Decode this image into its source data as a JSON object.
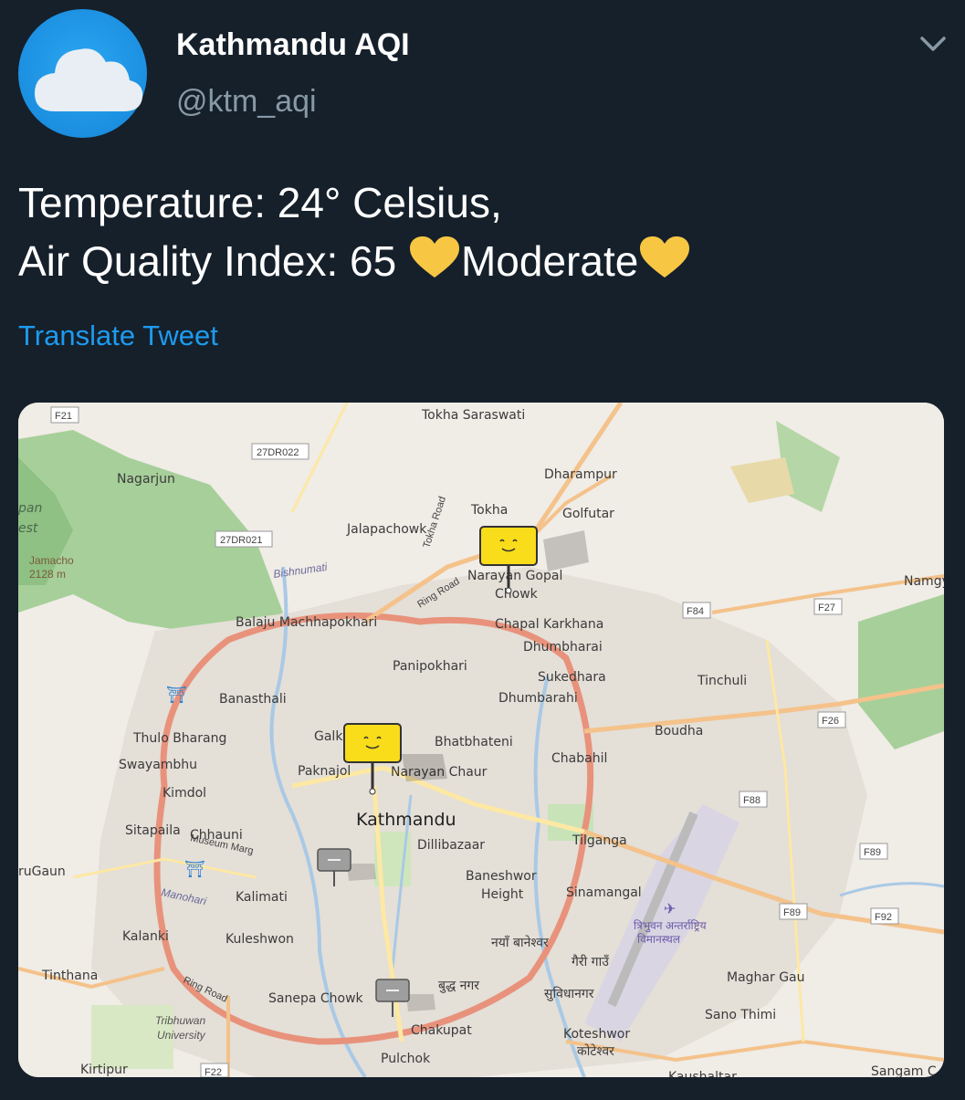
{
  "account": {
    "display_name": "Kathmandu AQI",
    "handle": "@ktm_aqi",
    "avatar_icon": "cloud-icon"
  },
  "tweet": {
    "line1": "Temperature: 24° Celsius,",
    "line2_prefix": "Air Quality Index: 65 ",
    "line2_status": "Moderate",
    "heart_color": "#f7c744"
  },
  "translate_label": "Translate Tweet",
  "colors": {
    "background": "#15202b",
    "link": "#1d9bf0",
    "muted": "#8899a6",
    "marker_moderate": "#f9dc1a",
    "marker_nodata": "#9e9e9e"
  },
  "map": {
    "place_labels": {
      "tokha_saraswati": "Tokha Saraswati",
      "nagarjun": "Nagarjun",
      "dharampur": "Dharampur",
      "tokha": "Tokha",
      "golfutar": "Golfutar",
      "jalapachowk": "Jalapachowk",
      "narayan_gopal": "Narayan Gopal",
      "chowk": "Chowk",
      "namgy": "Namgy",
      "chapal_karkhana": "Chapal Karkhana",
      "dhumbharai": "Dhumbharai",
      "balaju": "Balaju Machhapokhari",
      "panipokhari": "Panipokhari",
      "sukedhara": "Sukedhara",
      "dhumbarahi": "Dhumbarahi",
      "tinchuli": "Tinchuli",
      "banasthali": "Banasthali",
      "boudha": "Boudha",
      "thulo_bharang": "Thulo Bharang",
      "galk": "Galk",
      "bhatbhateni": "Bhatbhateni",
      "swayambhu": "Swayambhu",
      "chabahil": "Chabahil",
      "paknajol": "Paknajol",
      "narayan_chaur": "Narayan Chaur",
      "kimdol": "Kimdol",
      "kathmandu": "Kathmandu",
      "sitapaila": "Sitapaila",
      "chhauni": "Chhauni",
      "dillibazaar": "Dillibazaar",
      "tilganga": "Tilganga",
      "rugaun": "ruGaun",
      "baneshwor": "Baneshwor",
      "height": "Height",
      "kalimati": "Kalimati",
      "sinamangal": "Sinamangal",
      "kalanki": "Kalanki",
      "kuleshwon": "Kuleshwon",
      "naya_baneshwor_np": "नयाँ बानेश्वर",
      "gairi_gaun_np": "गैरी गाउँ",
      "tinthana": "Tinthana",
      "buddha_nagar_np": "बुद्ध नगर",
      "maghar_gau": "Maghar Gau",
      "sanepa_chowk": "Sanepa Chowk",
      "subidhanagar_np": "सुविधानगर",
      "sano_thimi": "Sano Thimi",
      "tribhuwan_university": "Tribhuwan",
      "university": "University",
      "chakupat": "Chakupat",
      "koteshwor": "Koteshwor",
      "koteshwor_np": "कोटेश्वर",
      "kirtipur": "Kirtipur",
      "pulchok": "Pulchok",
      "kaushaltar": "Kaushaltar",
      "sangam": "Sangam C",
      "jamacho": "Jamacho",
      "jamacho_elev": "2128 m",
      "airport_np1": "त्रिभुवन अन्तर्राष्ट्रिय",
      "airport_np2": "विमानस्थल",
      "forest_1": "pan",
      "forest_2": "est"
    },
    "road_labels": {
      "f21": "F21",
      "r27dr022": "27DR022",
      "r27dr021": "27DR021",
      "f84": "F84",
      "f27": "F27",
      "f26": "F26",
      "f88": "F88",
      "f89a": "F89",
      "f89b": "F89",
      "f92": "F92",
      "f22": "F22",
      "ring_road": "Ring Road",
      "tokha_road": "Tokha Road",
      "museum_marg": "Museum Marg",
      "bishnumati": "Bishnumati",
      "bagmati": "Manohari"
    },
    "markers": [
      {
        "name": "aqi-marker-narayan-gopal",
        "status": "moderate",
        "face": "smile"
      },
      {
        "name": "aqi-marker-paknajol",
        "status": "moderate",
        "face": "smile"
      },
      {
        "name": "aqi-marker-chhauni",
        "status": "no-data",
        "face": "--"
      },
      {
        "name": "aqi-marker-pulchok",
        "status": "no-data",
        "face": "--"
      }
    ]
  }
}
